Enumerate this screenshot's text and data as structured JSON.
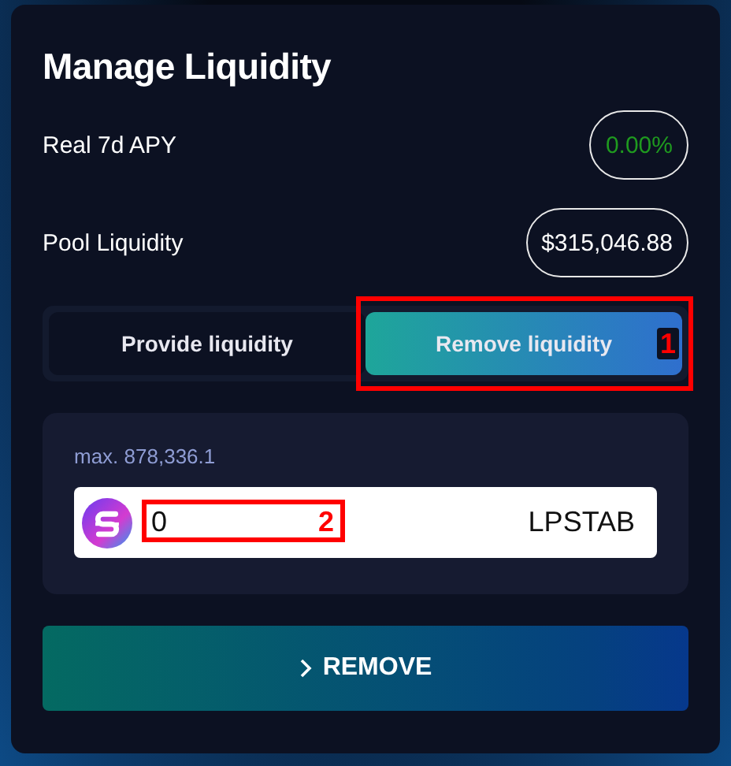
{
  "title": "Manage Liquidity",
  "stats": [
    {
      "label": "Real 7d APY",
      "value": "0.00%",
      "color": "#1f9a1f"
    },
    {
      "label": "Pool Liquidity",
      "value": "$315,046.88",
      "color": "#ffffff"
    }
  ],
  "tabs": [
    {
      "label": "Provide liquidity",
      "selected": false
    },
    {
      "label": "Remove liquidity",
      "selected": true,
      "annotation": "1"
    }
  ],
  "amount": {
    "max": "max. 878,336.1",
    "value": "0",
    "unit": "LPSTAB",
    "annotation": "2"
  },
  "action": {
    "label": "REMOVE"
  }
}
